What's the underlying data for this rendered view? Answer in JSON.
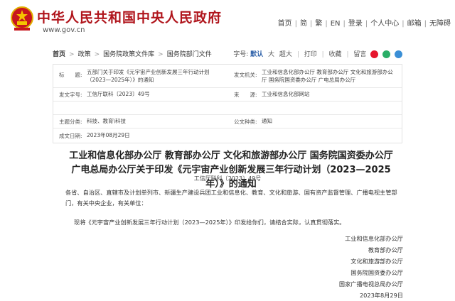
{
  "header": {
    "site_title": "中华人民共和国中央人民政府",
    "site_url": "www.gov.cn",
    "links": [
      "首页",
      "简",
      "繁",
      "EN",
      "登录",
      "个人中心",
      "邮箱",
      "无障碍"
    ]
  },
  "breadcrumb": {
    "items": [
      "首页",
      "政策",
      "国务院政策文件库",
      "国务院部门文件"
    ]
  },
  "tools": {
    "font_label": "字号:",
    "font_default": "默认",
    "font_large": "大",
    "font_xlarge": "超大",
    "print": "打印",
    "favorite": "收藏",
    "leave": "留言"
  },
  "meta": {
    "title_label": "标　　题:",
    "title_value": "五部门关于印发《元宇宙产业创新发展三年行动计划（2023—2025年）》的通知",
    "issuer_label": "发文机关:",
    "issuer_value": "工业和信息化部办公厅  教育部办公厅  文化和旅游部办公厅  国务院国资委办公厅  广电总局办公厅",
    "docno_label": "发文字号:",
    "docno_value": "工信厅联科〔2023〕49号",
    "source_label": "来　　源:",
    "source_value": "工业和信息化部网站",
    "category_label": "主题分类:",
    "category_value": "科技、教育\\科技",
    "type_label": "公文种类:",
    "type_value": "通知",
    "date_label": "成文日期:",
    "date_value": "2023年08月29日"
  },
  "doc": {
    "title": "工业和信息化部办公厅 教育部办公厅 文化和旅游部办公厅 国务院国资委办公厅 广电总局办公厅关于印发《元宇宙产业创新发展三年行动计划（2023—2025年）》的通知",
    "number": "工信厅联科〔2023〕49号",
    "addressees": "各省、自治区、直辖市及计划单列市、新疆生产建设兵团工业和信息化、教育、文化和旅游、国有资产监督管理、广播电视主管部门，有关中央企业，有关单位：",
    "paragraph": "现将《元宇宙产业创新发展三年行动计划（2023—2025年）》印发给你们，请结合实际，认真贯彻落实。",
    "signers": [
      "工业和信息化部办公厅",
      "教育部办公厅",
      "文化和旅游部办公厅",
      "国务院国资委办公厅",
      "国家广播电视总局办公厅"
    ],
    "date": "2023年8月29日"
  },
  "colors": {
    "brand_red": "#b0151c",
    "link_blue": "#2b5fa8"
  },
  "icons": {
    "emblem": "national-emblem-icon",
    "share": [
      "weibo-icon",
      "wechat-icon",
      "qq-icon"
    ]
  }
}
